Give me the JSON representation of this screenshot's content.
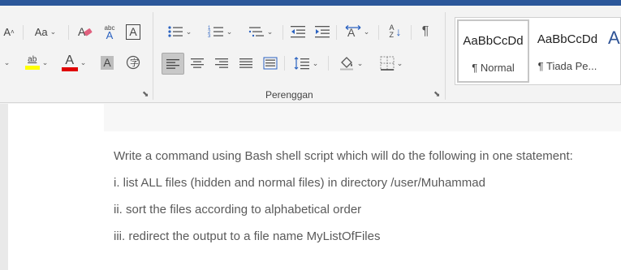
{
  "ribbon": {
    "paragraph_label": "Perenggan",
    "font": {
      "grow_icon": "A",
      "change_case_label": "Aa",
      "pinyin_icon": "abc",
      "border_char_icon": "A",
      "highlight_icon": "ab",
      "font_color_icon": "A",
      "shading_char_icon": "A",
      "highlight_color": "#ffff00",
      "font_color": "#e00000"
    },
    "paragraph": {
      "sort_icon": "AZ",
      "pilcrow_icon": "¶"
    },
    "styles": [
      {
        "sample": "AaBbCcDd",
        "name": "¶ Normal"
      },
      {
        "sample": "AaBbCcDd",
        "name": "¶ Tiada Pe..."
      },
      {
        "sample": "A",
        "name": ""
      }
    ]
  },
  "document": {
    "lines": [
      "Write a command using Bash shell script which will do the following in one statement:",
      "i.  list ALL files (hidden and normal files) in directory /user/Muhammad",
      "ii.  sort the files according to alphabetical order",
      "iii.  redirect the output to a file name MyListOfFiles"
    ]
  },
  "colors": {
    "title_bar": "#2b579a",
    "ribbon_bg": "#f3f3f3",
    "text_gray": "#5a5a5a"
  }
}
